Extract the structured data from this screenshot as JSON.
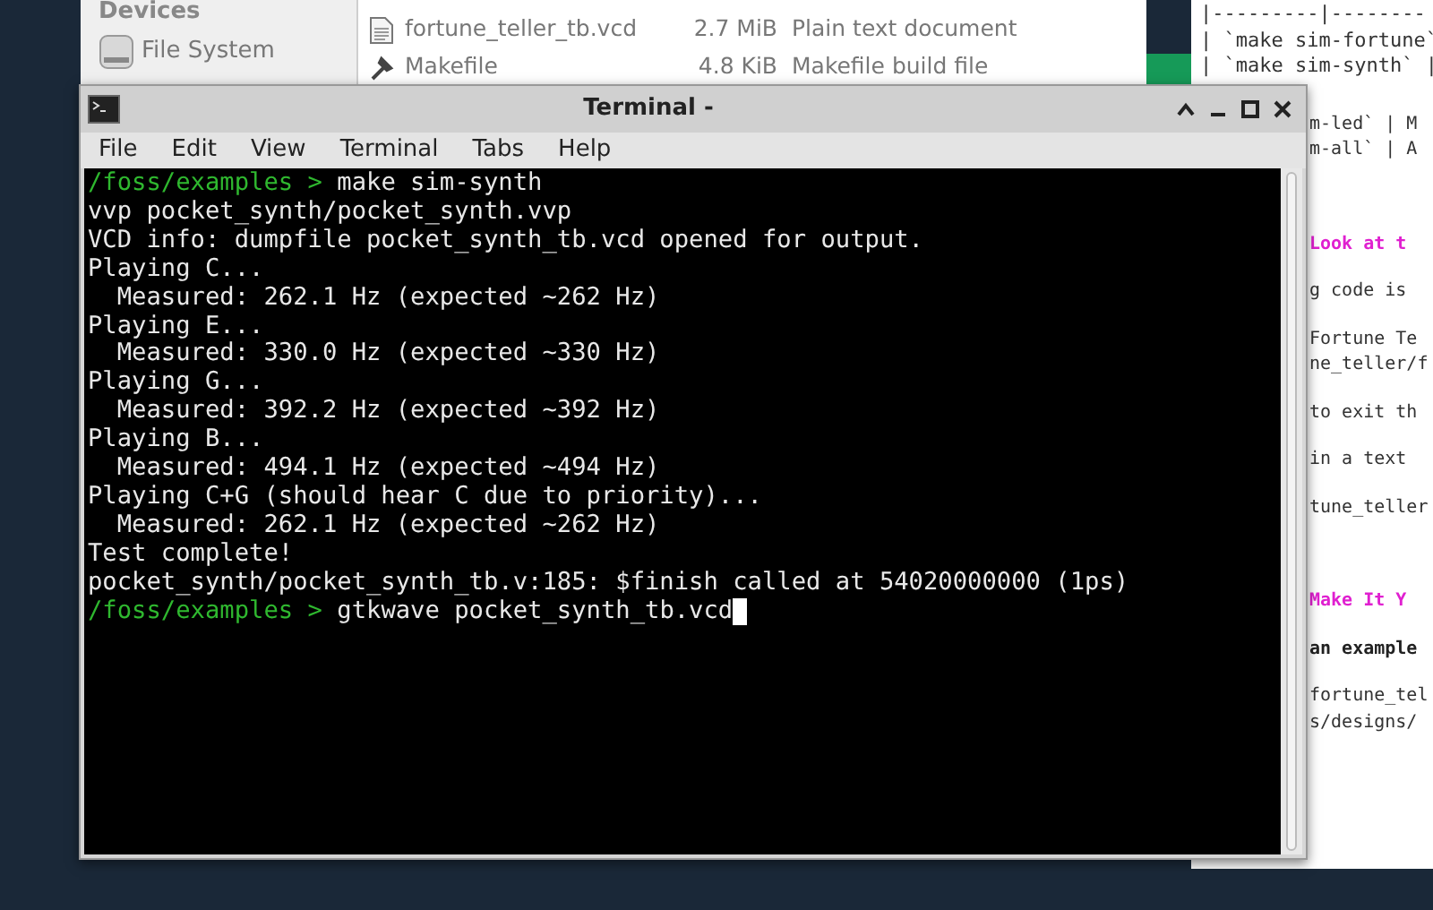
{
  "file_manager": {
    "sidebar": {
      "heading": "Devices",
      "items": [
        {
          "label": "File System"
        }
      ]
    },
    "files": [
      {
        "name": "fortune_teller_tb.vcd",
        "size": "2.7 MiB",
        "type": "Plain text document",
        "kind": "document"
      },
      {
        "name": "Makefile",
        "size": "4.8 KiB",
        "type": "Makefile build file",
        "kind": "build"
      }
    ]
  },
  "editor": {
    "top_lines": [
      "|---------|--------",
      "| `make sim-fortune`",
      "| `make sim-synth` |"
    ],
    "side_blocks": [
      {
        "kind": "plain",
        "lines": [
          "m-led` | M",
          "m-all` | A"
        ]
      },
      {
        "kind": "heading",
        "lines": [
          "Look at t"
        ]
      },
      {
        "kind": "plain",
        "lines": [
          "g code is"
        ]
      },
      {
        "kind": "code",
        "lines": [
          "Fortune Te",
          "ne_teller/f"
        ]
      },
      {
        "kind": "plain",
        "lines": [
          "to exit th"
        ]
      },
      {
        "kind": "plain",
        "lines": [
          "in a text"
        ]
      },
      {
        "kind": "plain",
        "lines": [
          "tune_teller"
        ]
      },
      {
        "kind": "heading",
        "lines": [
          "Make It Y"
        ]
      },
      {
        "kind": "bold",
        "lines": [
          "an example"
        ]
      },
      {
        "kind": "code",
        "lines": [
          "fortune_tel",
          "s/designs/"
        ]
      }
    ]
  },
  "terminal": {
    "title": "Terminal -",
    "menu": [
      "File",
      "Edit",
      "View",
      "Terminal",
      "Tabs",
      "Help"
    ],
    "lines": [
      {
        "kind": "prompt",
        "prompt": "/foss/examples > ",
        "text": "make sim-synth",
        "cursor": false
      },
      {
        "kind": "output",
        "text": "vvp pocket_synth/pocket_synth.vvp"
      },
      {
        "kind": "output",
        "text": "VCD info: dumpfile pocket_synth_tb.vcd opened for output."
      },
      {
        "kind": "output",
        "text": "Playing C..."
      },
      {
        "kind": "output",
        "text": "  Measured: 262.1 Hz (expected ~262 Hz)"
      },
      {
        "kind": "output",
        "text": "Playing E..."
      },
      {
        "kind": "output",
        "text": "  Measured: 330.0 Hz (expected ~330 Hz)"
      },
      {
        "kind": "output",
        "text": "Playing G..."
      },
      {
        "kind": "output",
        "text": "  Measured: 392.2 Hz (expected ~392 Hz)"
      },
      {
        "kind": "output",
        "text": "Playing B..."
      },
      {
        "kind": "output",
        "text": "  Measured: 494.1 Hz (expected ~494 Hz)"
      },
      {
        "kind": "output",
        "text": "Playing C+G (should hear C due to priority)..."
      },
      {
        "kind": "output",
        "text": "  Measured: 262.1 Hz (expected ~262 Hz)"
      },
      {
        "kind": "output",
        "text": "Test complete!"
      },
      {
        "kind": "output",
        "text": "pocket_synth/pocket_synth_tb.v:185: $finish called at 54020000000 (1ps)"
      },
      {
        "kind": "prompt",
        "prompt": "/foss/examples > ",
        "text": "gtkwave pocket_synth_tb.vcd",
        "cursor": true
      }
    ]
  }
}
